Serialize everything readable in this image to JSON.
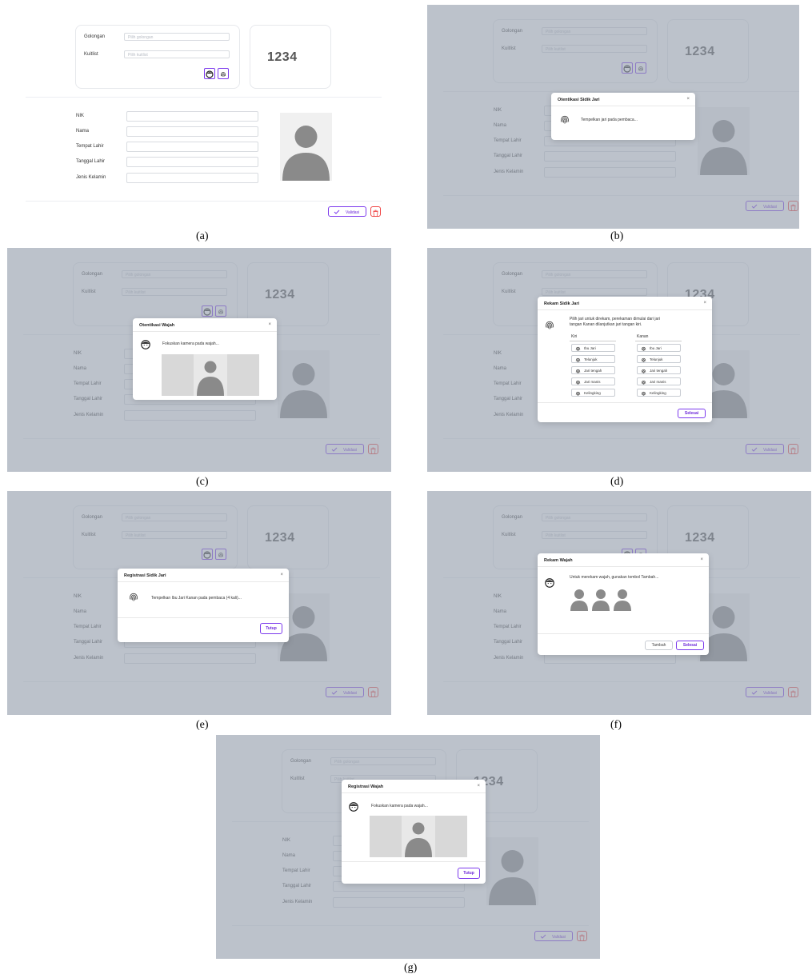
{
  "form": {
    "golongan_label": "Golongan",
    "golongan_placeholder": "Pilih golongan",
    "kuitlist_label": "Kuitlist",
    "kuitlist_placeholder": "Pilih kuitlist",
    "code": "1234",
    "nik_label": "NIK",
    "nama_label": "Nama",
    "tempat_lahir_label": "Tempat Lahir",
    "tanggal_lahir_label": "Tanggal Lahir",
    "jenis_kelamin_label": "Jenis Kelamin",
    "validasi_label": "Validasi"
  },
  "captions": [
    "(a)",
    "(b)",
    "(c)",
    "(d)",
    "(e)",
    "(f)",
    "(g)"
  ],
  "dialogs": {
    "b": {
      "title": "Otentikasi Sidik Jari",
      "message": "Tempelkan jari pada pembaca..."
    },
    "c": {
      "title": "Otentikasi Wajah",
      "message": "Fokuskan kamera pada wajah..."
    },
    "d": {
      "title": "Rekam Sidik Jari",
      "message_line1": "Pilih jari untuk direkam, perekaman dimulai dari jari",
      "message_line2": "tangan Kanan dilanjutkan jari tangan kiri.",
      "left_header": "Kiri",
      "right_header": "Kanan",
      "fingers_left": [
        "Ibu Jari",
        "Telunjuk",
        "Jari tengah",
        "Jari manis",
        "Kelingking"
      ],
      "fingers_right": [
        "Ibu Jari",
        "Telunjuk",
        "Jari tengah",
        "Jari manis",
        "Kelingking"
      ],
      "done_label": "Selesai"
    },
    "e": {
      "title": "Registrasi Sidik Jari",
      "message": "Tempelkan Ibu Jari Kanan pada pembaca (4 kali)...",
      "close_label": "Tutup"
    },
    "f": {
      "title": "Rekam Wajah",
      "message": "Untuk merekam wajah, gunakan tombol Tambah...",
      "add_label": "Tambah",
      "done_label": "Selesai"
    },
    "g": {
      "title": "Registrasi Wajah",
      "message": "Fokuskan kamera pada wajah...",
      "close_label": "Tutup"
    }
  },
  "colors": {
    "accent": "#7c3aed",
    "danger": "#ef4444",
    "overlay": "#96a0ae"
  },
  "icons": [
    "face-icon",
    "fingerprint-icon",
    "check-icon",
    "trash-icon",
    "close-icon",
    "avatar-silhouette"
  ]
}
